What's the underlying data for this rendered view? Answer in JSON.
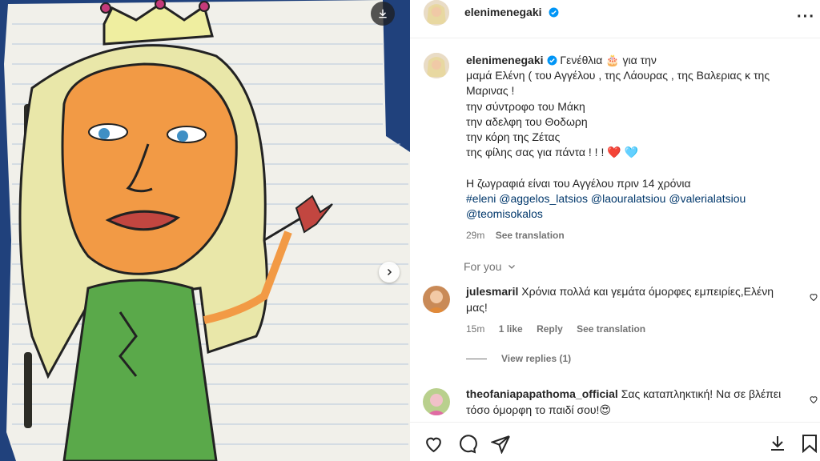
{
  "post": {
    "author": "elenimenegaki",
    "caption_lines": [
      "Γενέθλια 🎂 για την",
      "μαμά Ελένη ( του Αγγέλου , της Λάουρας , της Βαλεριας κ της",
      "Μαρινας !",
      "την σύντροφο του Μάκη",
      "την αδελφη του Θοδωρη",
      "την κόρη της Ζέτας",
      "της φίλης σας για πάντα ! ! ! ❤️ 🩵",
      "",
      "Η ζωγραφιά είναι του Αγγέλου πριν 14 χρόνια"
    ],
    "hashtags_line1": "#eleni @aggelos_latsios @laouralatsiou @valerialatsiou",
    "hashtags_line2": "@teomisokalos",
    "time": "29m",
    "see_translation": "See translation"
  },
  "for_you": "For you",
  "comments": [
    {
      "username": "julesmaril",
      "text_line1": "Χρόνια πολλά και γεμάτα όμορφες εμπειρίες,Ελένη",
      "text_line2": "μας!",
      "time": "15m",
      "likes": "1 like",
      "reply": "Reply",
      "see_translation": "See translation"
    },
    {
      "username": "theofaniapapathoma_official",
      "text_line1": "Σας καταπληκτική! Να σε βλέπει",
      "text_line2": "τόσο όμορφη το παιδί σου!😍"
    }
  ],
  "view_replies": "View replies (1)",
  "colors": {
    "verified": "#0095f6",
    "link": "#00376b",
    "secondary": "#737373",
    "media_bg": "#1f3f7a"
  },
  "icons": [
    "download-icon",
    "chevron-right-icon",
    "verified-icon",
    "more-icon",
    "heart-icon",
    "comment-icon",
    "share-icon",
    "save-icon",
    "chevron-down-icon"
  ]
}
